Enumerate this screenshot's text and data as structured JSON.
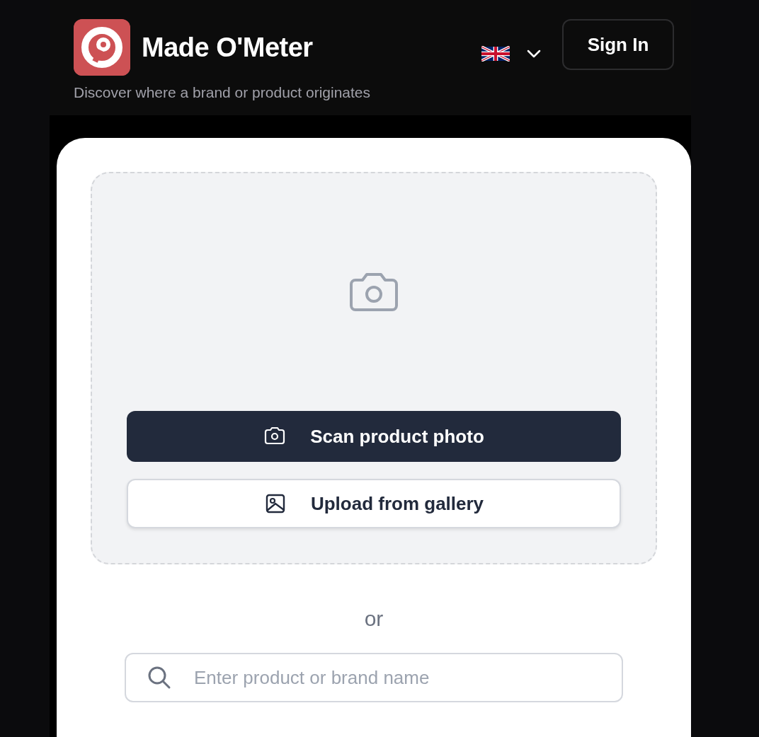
{
  "header": {
    "brand": "Made O'Meter",
    "tagline": "Discover where a brand or product originates",
    "sign_in": "Sign In"
  },
  "upload_area": {
    "buttons": [
      {
        "kind": "primary",
        "label": "Scan product photo"
      },
      {
        "kind": "secondary",
        "label": "Upload from gallery"
      }
    ]
  },
  "separator": "or",
  "search": {
    "placeholder": "Enter product or brand name"
  }
}
